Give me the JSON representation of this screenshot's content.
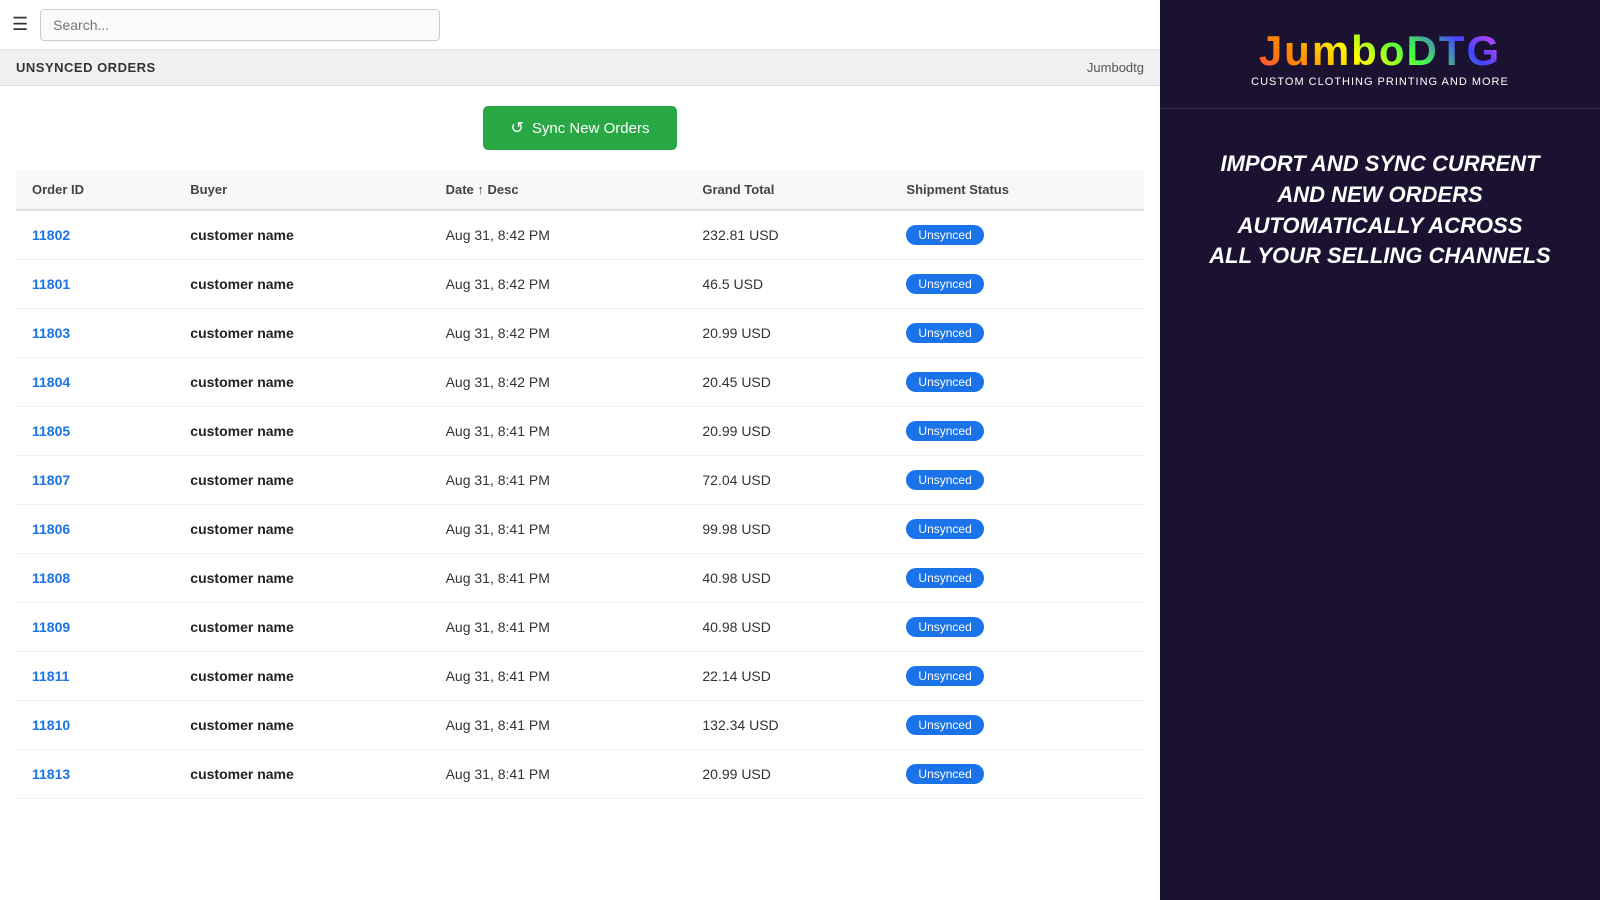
{
  "topbar": {
    "search_placeholder": "Search..."
  },
  "page_header": {
    "title": "UNSYNCED ORDERS",
    "brand": "Jumbodtg"
  },
  "sync_button": {
    "label": "Sync New Orders"
  },
  "table": {
    "columns": [
      "Order ID",
      "Buyer",
      "Date ↑ Desc",
      "Grand Total",
      "Shipment Status"
    ],
    "rows": [
      {
        "order_id": "11802",
        "buyer": "customer name",
        "date": "Aug 31, 8:42 PM",
        "total": "232.81 USD",
        "status": "Unsynced"
      },
      {
        "order_id": "11801",
        "buyer": "customer name",
        "date": "Aug 31, 8:42 PM",
        "total": "46.5 USD",
        "status": "Unsynced"
      },
      {
        "order_id": "11803",
        "buyer": "customer name",
        "date": "Aug 31, 8:42 PM",
        "total": "20.99 USD",
        "status": "Unsynced"
      },
      {
        "order_id": "11804",
        "buyer": "customer name",
        "date": "Aug 31, 8:42 PM",
        "total": "20.45 USD",
        "status": "Unsynced"
      },
      {
        "order_id": "11805",
        "buyer": "customer name",
        "date": "Aug 31, 8:41 PM",
        "total": "20.99 USD",
        "status": "Unsynced"
      },
      {
        "order_id": "11807",
        "buyer": "customer name",
        "date": "Aug 31, 8:41 PM",
        "total": "72.04 USD",
        "status": "Unsynced"
      },
      {
        "order_id": "11806",
        "buyer": "customer name",
        "date": "Aug 31, 8:41 PM",
        "total": "99.98 USD",
        "status": "Unsynced"
      },
      {
        "order_id": "11808",
        "buyer": "customer name",
        "date": "Aug 31, 8:41 PM",
        "total": "40.98 USD",
        "status": "Unsynced"
      },
      {
        "order_id": "11809",
        "buyer": "customer name",
        "date": "Aug 31, 8:41 PM",
        "total": "40.98 USD",
        "status": "Unsynced"
      },
      {
        "order_id": "11811",
        "buyer": "customer name",
        "date": "Aug 31, 8:41 PM",
        "total": "22.14 USD",
        "status": "Unsynced"
      },
      {
        "order_id": "11810",
        "buyer": "customer name",
        "date": "Aug 31, 8:41 PM",
        "total": "132.34 USD",
        "status": "Unsynced"
      },
      {
        "order_id": "11813",
        "buyer": "customer name",
        "date": "Aug 31, 8:41 PM",
        "total": "20.99 USD",
        "status": "Unsynced"
      }
    ]
  },
  "sidebar": {
    "logo_title": "JumboDTG",
    "logo_subtitle": "Custom Clothing Printing and More",
    "promo_line1": "Import and sync current",
    "promo_line2": "and new orders",
    "promo_line3": "automatically across",
    "promo_line4": "all your selling channels"
  }
}
